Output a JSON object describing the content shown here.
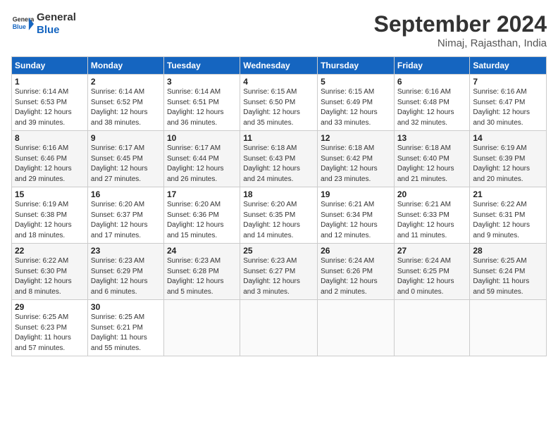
{
  "logo": {
    "line1": "General",
    "line2": "Blue"
  },
  "title": "September 2024",
  "location": "Nimaj, Rajasthan, India",
  "days_header": [
    "Sunday",
    "Monday",
    "Tuesday",
    "Wednesday",
    "Thursday",
    "Friday",
    "Saturday"
  ],
  "weeks": [
    [
      {
        "day": "1",
        "info": "Sunrise: 6:14 AM\nSunset: 6:53 PM\nDaylight: 12 hours\nand 39 minutes."
      },
      {
        "day": "2",
        "info": "Sunrise: 6:14 AM\nSunset: 6:52 PM\nDaylight: 12 hours\nand 38 minutes."
      },
      {
        "day": "3",
        "info": "Sunrise: 6:14 AM\nSunset: 6:51 PM\nDaylight: 12 hours\nand 36 minutes."
      },
      {
        "day": "4",
        "info": "Sunrise: 6:15 AM\nSunset: 6:50 PM\nDaylight: 12 hours\nand 35 minutes."
      },
      {
        "day": "5",
        "info": "Sunrise: 6:15 AM\nSunset: 6:49 PM\nDaylight: 12 hours\nand 33 minutes."
      },
      {
        "day": "6",
        "info": "Sunrise: 6:16 AM\nSunset: 6:48 PM\nDaylight: 12 hours\nand 32 minutes."
      },
      {
        "day": "7",
        "info": "Sunrise: 6:16 AM\nSunset: 6:47 PM\nDaylight: 12 hours\nand 30 minutes."
      }
    ],
    [
      {
        "day": "8",
        "info": "Sunrise: 6:16 AM\nSunset: 6:46 PM\nDaylight: 12 hours\nand 29 minutes."
      },
      {
        "day": "9",
        "info": "Sunrise: 6:17 AM\nSunset: 6:45 PM\nDaylight: 12 hours\nand 27 minutes."
      },
      {
        "day": "10",
        "info": "Sunrise: 6:17 AM\nSunset: 6:44 PM\nDaylight: 12 hours\nand 26 minutes."
      },
      {
        "day": "11",
        "info": "Sunrise: 6:18 AM\nSunset: 6:43 PM\nDaylight: 12 hours\nand 24 minutes."
      },
      {
        "day": "12",
        "info": "Sunrise: 6:18 AM\nSunset: 6:42 PM\nDaylight: 12 hours\nand 23 minutes."
      },
      {
        "day": "13",
        "info": "Sunrise: 6:18 AM\nSunset: 6:40 PM\nDaylight: 12 hours\nand 21 minutes."
      },
      {
        "day": "14",
        "info": "Sunrise: 6:19 AM\nSunset: 6:39 PM\nDaylight: 12 hours\nand 20 minutes."
      }
    ],
    [
      {
        "day": "15",
        "info": "Sunrise: 6:19 AM\nSunset: 6:38 PM\nDaylight: 12 hours\nand 18 minutes."
      },
      {
        "day": "16",
        "info": "Sunrise: 6:20 AM\nSunset: 6:37 PM\nDaylight: 12 hours\nand 17 minutes."
      },
      {
        "day": "17",
        "info": "Sunrise: 6:20 AM\nSunset: 6:36 PM\nDaylight: 12 hours\nand 15 minutes."
      },
      {
        "day": "18",
        "info": "Sunrise: 6:20 AM\nSunset: 6:35 PM\nDaylight: 12 hours\nand 14 minutes."
      },
      {
        "day": "19",
        "info": "Sunrise: 6:21 AM\nSunset: 6:34 PM\nDaylight: 12 hours\nand 12 minutes."
      },
      {
        "day": "20",
        "info": "Sunrise: 6:21 AM\nSunset: 6:33 PM\nDaylight: 12 hours\nand 11 minutes."
      },
      {
        "day": "21",
        "info": "Sunrise: 6:22 AM\nSunset: 6:31 PM\nDaylight: 12 hours\nand 9 minutes."
      }
    ],
    [
      {
        "day": "22",
        "info": "Sunrise: 6:22 AM\nSunset: 6:30 PM\nDaylight: 12 hours\nand 8 minutes."
      },
      {
        "day": "23",
        "info": "Sunrise: 6:23 AM\nSunset: 6:29 PM\nDaylight: 12 hours\nand 6 minutes."
      },
      {
        "day": "24",
        "info": "Sunrise: 6:23 AM\nSunset: 6:28 PM\nDaylight: 12 hours\nand 5 minutes."
      },
      {
        "day": "25",
        "info": "Sunrise: 6:23 AM\nSunset: 6:27 PM\nDaylight: 12 hours\nand 3 minutes."
      },
      {
        "day": "26",
        "info": "Sunrise: 6:24 AM\nSunset: 6:26 PM\nDaylight: 12 hours\nand 2 minutes."
      },
      {
        "day": "27",
        "info": "Sunrise: 6:24 AM\nSunset: 6:25 PM\nDaylight: 12 hours\nand 0 minutes."
      },
      {
        "day": "28",
        "info": "Sunrise: 6:25 AM\nSunset: 6:24 PM\nDaylight: 11 hours\nand 59 minutes."
      }
    ],
    [
      {
        "day": "29",
        "info": "Sunrise: 6:25 AM\nSunset: 6:23 PM\nDaylight: 11 hours\nand 57 minutes."
      },
      {
        "day": "30",
        "info": "Sunrise: 6:25 AM\nSunset: 6:21 PM\nDaylight: 11 hours\nand 55 minutes."
      },
      {
        "day": "",
        "info": ""
      },
      {
        "day": "",
        "info": ""
      },
      {
        "day": "",
        "info": ""
      },
      {
        "day": "",
        "info": ""
      },
      {
        "day": "",
        "info": ""
      }
    ]
  ]
}
